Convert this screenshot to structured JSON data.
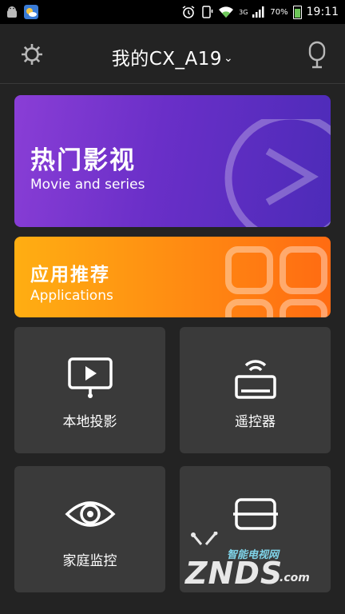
{
  "status_bar": {
    "battery": "70%",
    "time": "19:11",
    "network": "3G"
  },
  "app_bar": {
    "title": "我的CX_A19",
    "title_chevron": "⌄"
  },
  "cards": {
    "movie": {
      "title": "热门影视",
      "subtitle": "Movie and series"
    },
    "apps": {
      "title": "应用推荐",
      "subtitle": "Applications"
    }
  },
  "tiles": {
    "local_cast": {
      "label": "本地投影"
    },
    "remote": {
      "label": "遥控器"
    },
    "home_monitor": {
      "label": "家庭监控"
    }
  },
  "watermark": {
    "cn": "智能电视网",
    "main": "ZNDS",
    "suffix": ".com"
  },
  "colors": {
    "movie_card": "#6a2fc8",
    "apps_card": "#ff8a12",
    "tile_bg": "#3a3a3a",
    "page_bg": "#232323"
  }
}
